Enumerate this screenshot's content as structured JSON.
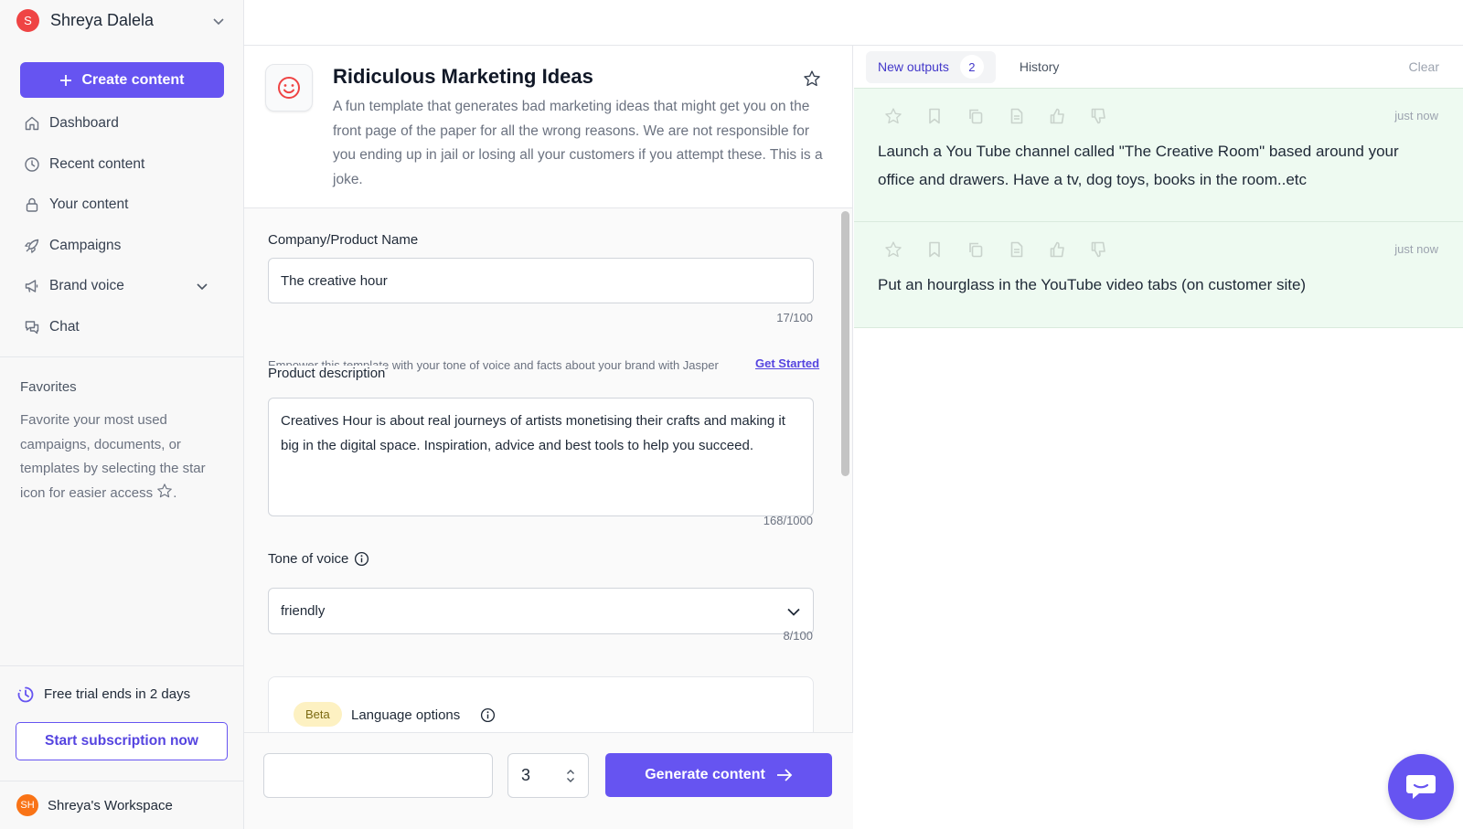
{
  "user": {
    "initial": "S",
    "name": "Shreya Dalela"
  },
  "sidebar": {
    "create_label": "Create content",
    "items": [
      {
        "label": "Dashboard",
        "icon": "home-icon"
      },
      {
        "label": "Recent content",
        "icon": "clock-icon"
      },
      {
        "label": "Your content",
        "icon": "lock-icon"
      },
      {
        "label": "Campaigns",
        "icon": "rocket-icon"
      },
      {
        "label": "Brand voice",
        "icon": "megaphone-icon"
      },
      {
        "label": "Chat",
        "icon": "chat-icon"
      }
    ],
    "favorites_title": "Favorites",
    "favorites_text": "Favorite your most used campaigns, documents, or templates by selecting the star icon for easier access",
    "favorites_text_end": ".",
    "trial_text": "Free trial ends in 2 days",
    "subscribe_label": "Start subscription now",
    "workspace_initials": "SH",
    "workspace_name": "Shreya's Workspace"
  },
  "template": {
    "title": "Ridiculous Marketing Ideas",
    "description": "A fun template that generates bad marketing ideas that might get you on the front page of the paper for all the wrong reasons. We are not responsible for you ending up in jail or losing all your customers if you attempt these. This is a joke."
  },
  "form": {
    "company_label": "Company/Product Name",
    "company_value": "The creative hour",
    "company_counter": "17/100",
    "brand_voice_note": "Empower this template with your tone of voice and facts about your brand with Jasper",
    "brand_voice_link": "Get Started",
    "desc_label": "Product description",
    "desc_value": "Creatives Hour is about real journeys of artists monetising their crafts and making it big in the digital space. Inspiration, advice and best tools to help you succeed.",
    "desc_counter": "168/1000",
    "tone_label": "Tone of voice",
    "tone_value": "friendly",
    "tone_counter": "8/100",
    "beta_badge": "Beta",
    "language_label": "Language options"
  },
  "actions": {
    "output_count": "3",
    "generate_label": "Generate content"
  },
  "outputs": {
    "tab_new": "New outputs",
    "tab_new_count": "2",
    "tab_history": "History",
    "clear_label": "Clear",
    "items": [
      {
        "time": "just now",
        "text": "Launch a You Tube channel called \"The Creative Room\" based around your office and drawers. Have a tv, dog toys, books in the room..etc"
      },
      {
        "time": "just now",
        "text": "Put an hourglass in the YouTube video tabs (on customer site)"
      }
    ]
  },
  "colors": {
    "accent": "#6654f1",
    "output_bg": "#eefaf1",
    "avatar": "#ef4444",
    "workspace_avatar": "#f97316"
  }
}
